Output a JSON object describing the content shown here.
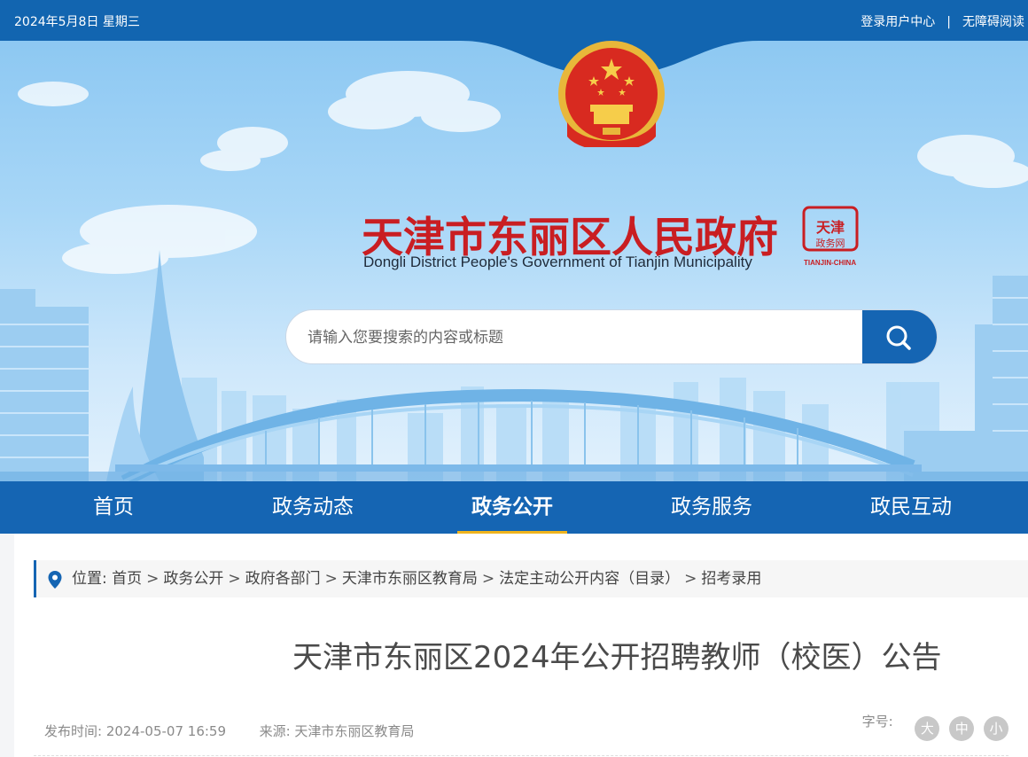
{
  "topbar": {
    "date": "2024年5月8日 星期三",
    "login_label": "登录用户中心",
    "separator": "|",
    "accessibility_label": "无障碍阅读"
  },
  "header": {
    "title_cn": "天津市东丽区人民政府",
    "title_en": "Dongli District People's Government of Tianjin Municipality",
    "seal_text": "天津政务网",
    "seal_caption": "TIANJIN-CHINA"
  },
  "search": {
    "placeholder": "请输入您要搜索的内容或标题",
    "icon": "search-icon"
  },
  "nav": {
    "items": [
      {
        "label": "首页"
      },
      {
        "label": "政务动态"
      },
      {
        "label": "政务公开"
      },
      {
        "label": "政务服务"
      },
      {
        "label": "政民互动"
      }
    ],
    "active_index": 2
  },
  "breadcrumb": {
    "prefix": "位置:",
    "items": [
      "首页",
      "政务公开",
      "政府各部门",
      "天津市东丽区教育局",
      "法定主动公开内容（目录）",
      "招考录用"
    ],
    "separator": ">"
  },
  "article": {
    "title": "天津市东丽区2024年公开招聘教师（校医）公告",
    "publish_label": "发布时间:",
    "publish_time": "2024-05-07 16:59",
    "source_label": "来源:",
    "source": "天津市东丽区教育局",
    "font_size_label": "字号:",
    "font_sizes": [
      "大",
      "中",
      "小"
    ]
  },
  "colors": {
    "primary": "#1565b3",
    "title_red": "#c91e22",
    "active_underline": "#f0b41d"
  }
}
